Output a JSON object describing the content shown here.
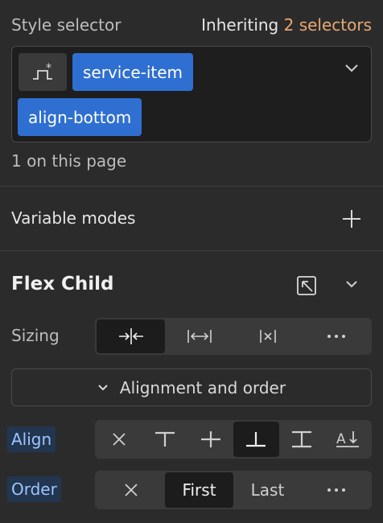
{
  "style_selector": {
    "label": "Style selector",
    "inheriting_prefix": "Inheriting",
    "inheriting_count": "2 selectors",
    "chips": [
      "service-item",
      "align-bottom"
    ],
    "page_count": "1 on this page"
  },
  "variable_modes": {
    "label": "Variable modes"
  },
  "flex_child": {
    "title": "Flex Child",
    "sizing_label": "Sizing",
    "sizing_options": [
      "shrink-icon",
      "grow-icon",
      "none-icon",
      "more-icon"
    ],
    "alignment_button": "Alignment and order",
    "align_label": "Align",
    "align_options": [
      "none",
      "start",
      "center",
      "end",
      "stretch",
      "baseline"
    ],
    "align_selected": "end",
    "order_label": "Order",
    "order_options": [
      "First",
      "Last"
    ],
    "order_selected": "First"
  },
  "colors": {
    "accent_chip": "#2f6fd1",
    "inheriting_accent": "#e8a873",
    "background": "#2b2b2b"
  }
}
